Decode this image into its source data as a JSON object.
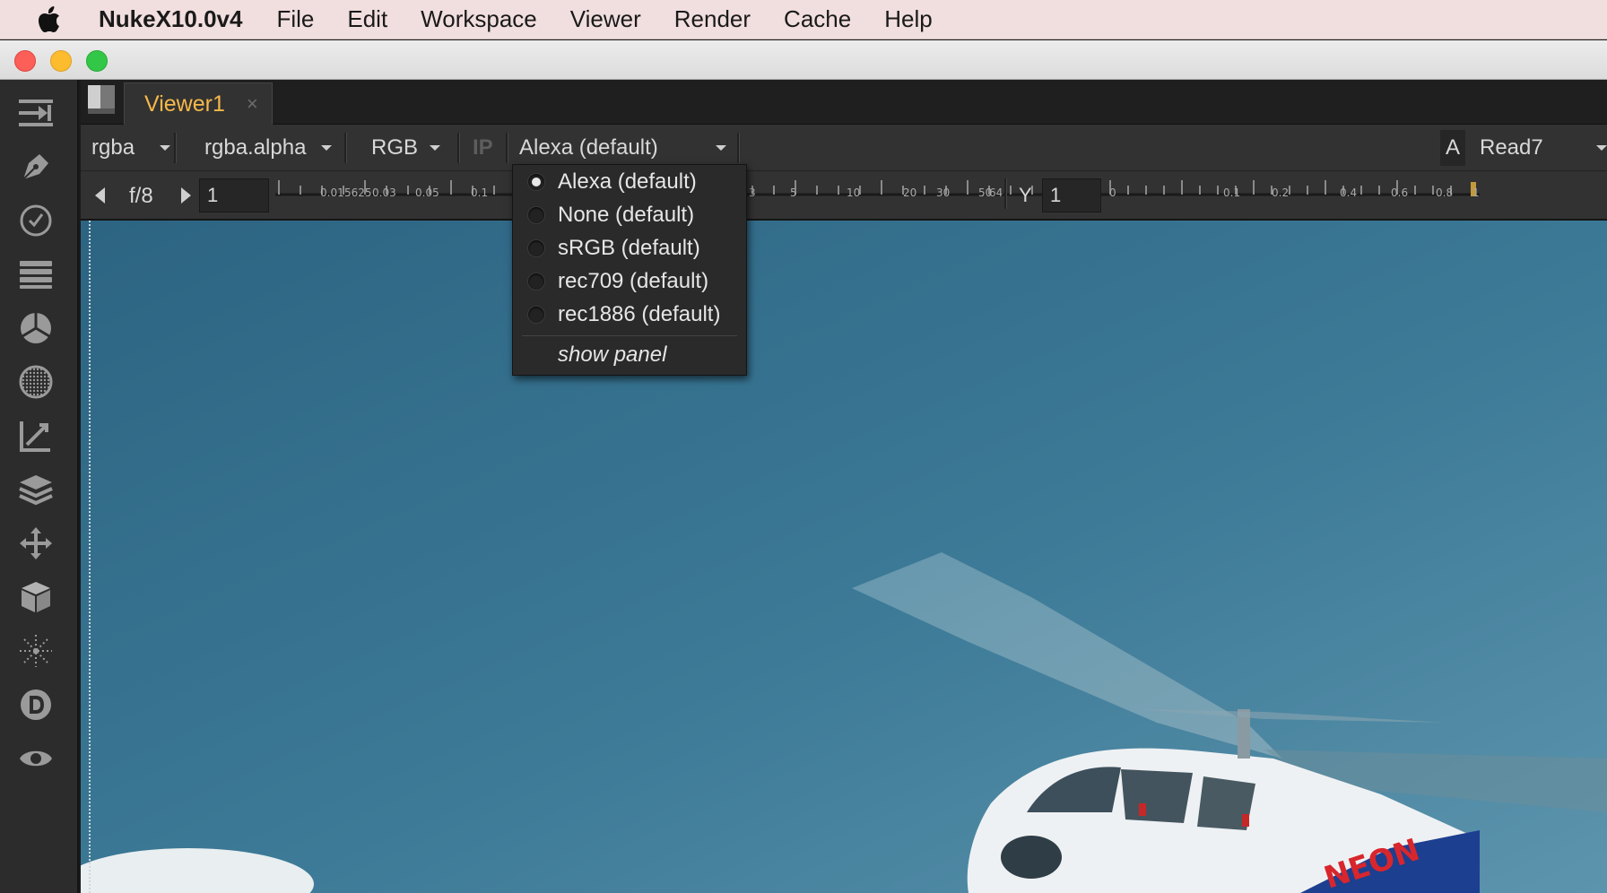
{
  "menubar": {
    "app_name": "NukeX10.0v4",
    "items": [
      "File",
      "Edit",
      "Workspace",
      "Viewer",
      "Render",
      "Cache",
      "Help"
    ]
  },
  "window": {
    "tab": {
      "label": "Viewer1",
      "close": "×"
    }
  },
  "viewer_controls": {
    "channels": "rgba",
    "alpha_channel": "rgba.alpha",
    "display_channels": "RGB",
    "ip": "IP",
    "viewer_process": "Alexa (default)",
    "input_label": "A",
    "input_node": "Read7",
    "fstop": "f/8",
    "gain_value": "1",
    "gamma_label": "Y",
    "gamma_value": "1",
    "gain_scale": [
      "0.01",
      "5625",
      "0.03",
      "0.05",
      "0.1",
      "3",
      "5",
      "10",
      "20",
      "30",
      "50",
      "64"
    ],
    "gamma_scale": [
      "0",
      "0.1",
      "0.2",
      "0.4",
      "0.6",
      "0.8",
      "1"
    ]
  },
  "lut_menu": {
    "options": [
      {
        "label": "Alexa (default)",
        "selected": true
      },
      {
        "label": "None (default)",
        "selected": false
      },
      {
        "label": "sRGB (default)",
        "selected": false
      },
      {
        "label": "rec709 (default)",
        "selected": false
      },
      {
        "label": "rec1886 (default)",
        "selected": false
      }
    ],
    "show_panel": "show panel"
  },
  "toolbar_icons": [
    "image-io-icon",
    "draw-icon",
    "time-icon",
    "channel-icon",
    "color-icon",
    "filter-icon",
    "keyer-icon",
    "merge-icon",
    "transform-icon",
    "3d-icon",
    "particles-icon",
    "deep-icon",
    "views-icon"
  ],
  "image_decal": "NEON",
  "colors": {
    "accent_tab": "#f6b84a",
    "panel_bg": "#323232",
    "sky": "#2d6885"
  }
}
